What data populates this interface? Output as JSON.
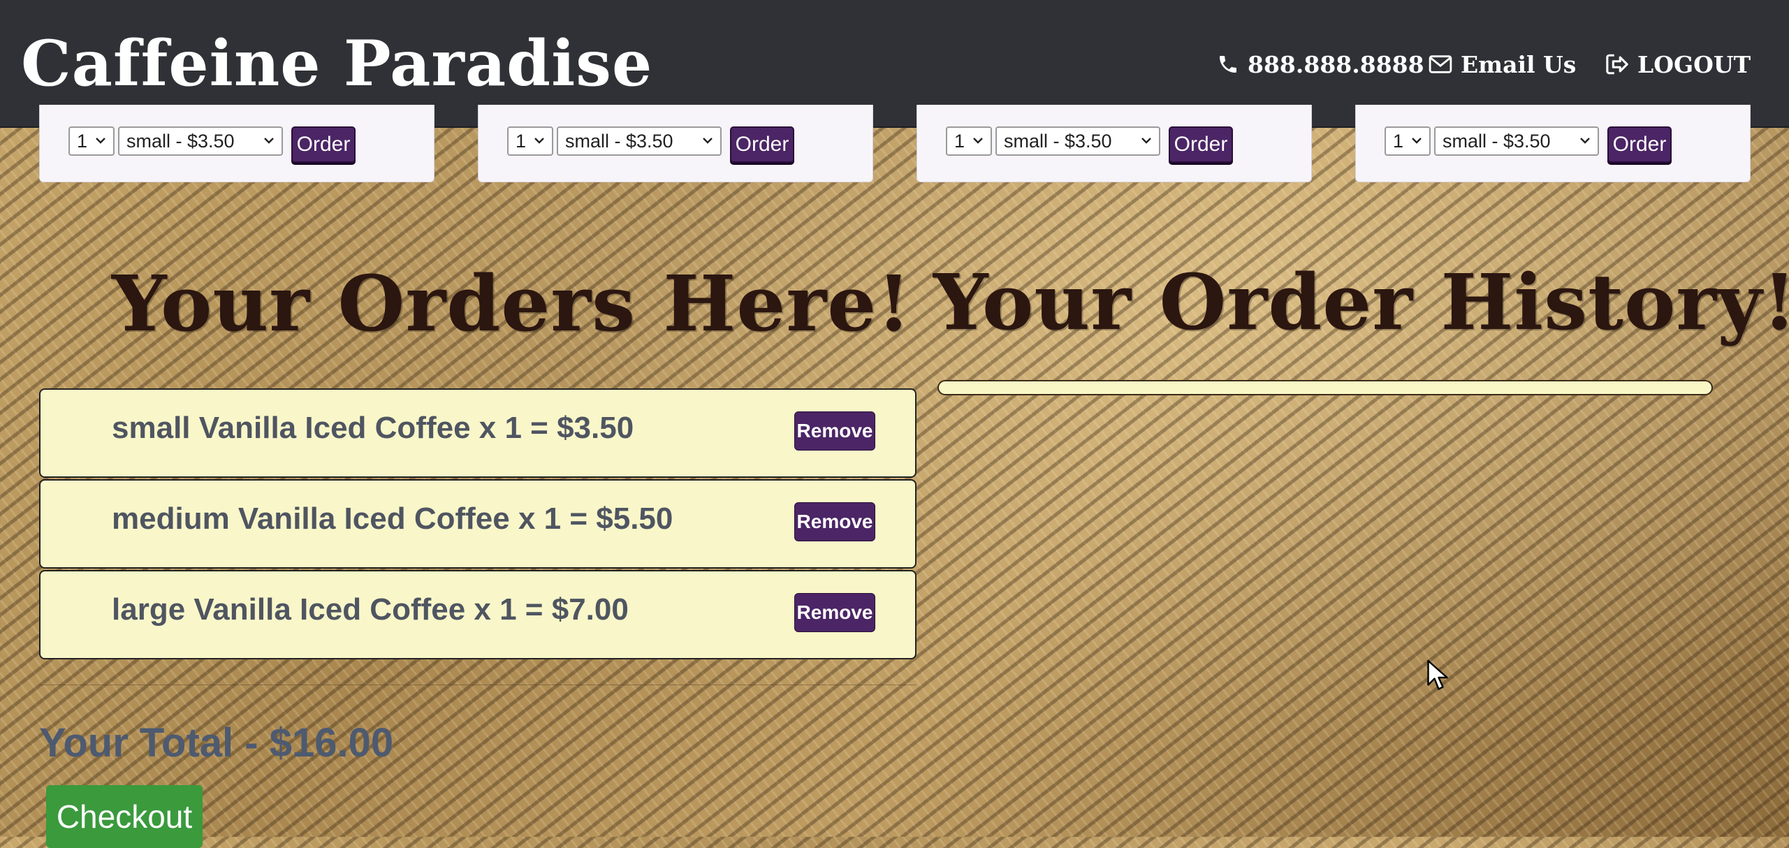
{
  "header": {
    "brand": "Caffeine Paradise",
    "phone_label": "888.888.8888",
    "email_label": "Email Us",
    "logout_label": "LOGOUT",
    "icons": {
      "phone": "phone-icon",
      "email": "envelope-icon",
      "logout": "logout-icon"
    }
  },
  "products": [
    {
      "qty": "1",
      "size": "small - $3.50",
      "order_label": "Order"
    },
    {
      "qty": "1",
      "size": "small - $3.50",
      "order_label": "Order"
    },
    {
      "qty": "1",
      "size": "small - $3.50",
      "order_label": "Order"
    },
    {
      "qty": "1",
      "size": "small - $3.50",
      "order_label": "Order"
    }
  ],
  "orders": {
    "heading": "Your Orders Here!",
    "items": [
      {
        "text": "small Vanilla Iced Coffee x 1 = $3.50",
        "remove_label": "Remove"
      },
      {
        "text": "medium Vanilla Iced Coffee x 1 = $5.50",
        "remove_label": "Remove"
      },
      {
        "text": "large Vanilla Iced Coffee x 1 = $7.00",
        "remove_label": "Remove"
      }
    ],
    "total": "Your Total - $16.00",
    "checkout_label": "Checkout"
  },
  "history": {
    "heading": "Your Order History!"
  },
  "colors": {
    "navbar": "#2f3136",
    "accent_purple": "#4b2565",
    "order_bg": "#f9f7c9",
    "checkout_green": "#3a9a3c",
    "heading_brown": "#2b1610"
  }
}
